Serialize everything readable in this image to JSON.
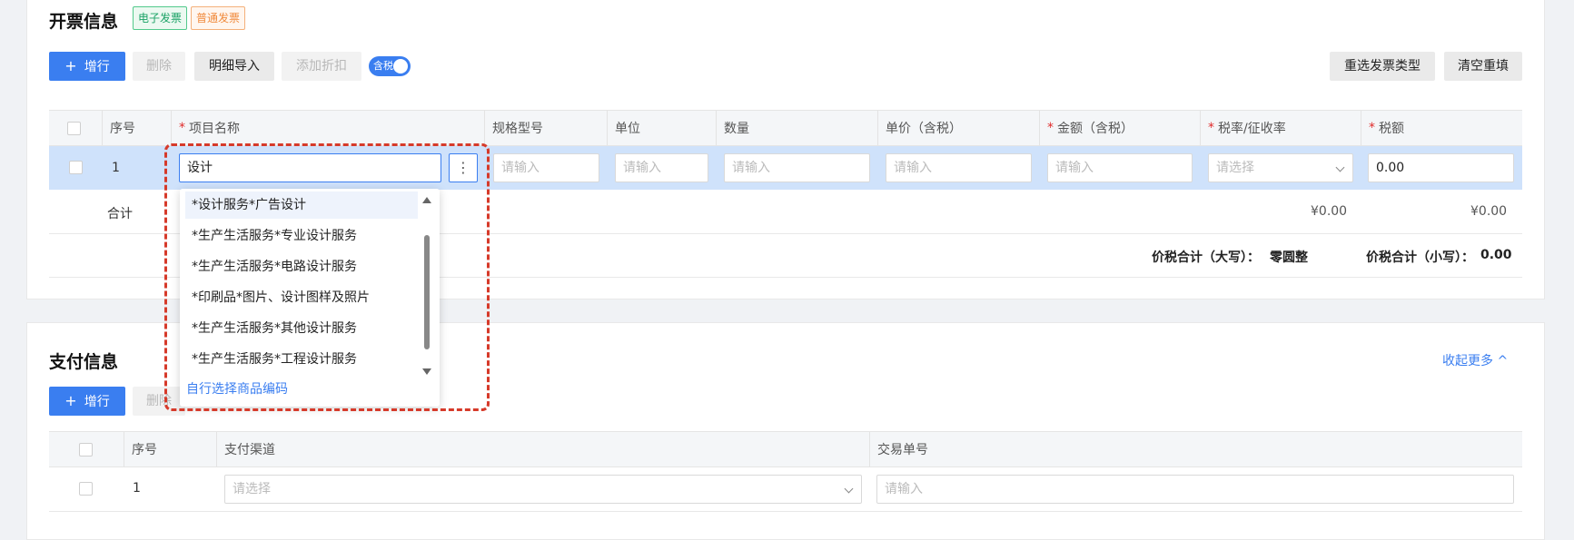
{
  "invoice": {
    "title": "开票信息",
    "tag_electronic": "电子发票",
    "tag_normal": "普通发票",
    "toolbar": {
      "add_row": "增行",
      "delete": "删除",
      "import_detail": "明细导入",
      "add_discount": "添加折扣",
      "tax_toggle": "含税",
      "reselect_type": "重选发票类型",
      "clear_refill": "清空重填"
    },
    "columns": {
      "index": "序号",
      "item_name": "项目名称",
      "spec": "规格型号",
      "unit": "单位",
      "quantity": "数量",
      "unit_price": "单价（含税）",
      "amount": "金额（含税）",
      "tax_rate": "税率/征收率",
      "tax": "税额"
    },
    "row": {
      "index": "1",
      "item_name_value": "设计",
      "input_placeholder": "请输入",
      "select_placeholder": "请选择",
      "tax_value": "0.00"
    },
    "subtotal": {
      "label": "合计",
      "amount": "¥0.00",
      "tax": "¥0.00"
    },
    "total": {
      "upper_label": "价税合计（大写）：",
      "upper_value": "零圆整",
      "lower_label": "价税合计（小写）：",
      "lower_value": "0.00"
    },
    "dropdown": {
      "items": [
        "*设计服务*广告设计",
        "*生产生活服务*专业设计服务",
        "*生产生活服务*电路设计服务",
        "*印刷品*图片、设计图样及照片",
        "*生产生活服务*其他设计服务",
        "*生产生活服务*工程设计服务"
      ],
      "custom_link": "自行选择商品编码"
    }
  },
  "payment": {
    "title": "支付信息",
    "collapse": "收起更多",
    "add_row": "增行",
    "delete": "删除",
    "columns": {
      "index": "序号",
      "channel": "支付渠道",
      "trade_no": "交易单号"
    },
    "row": {
      "index": "1",
      "channel_placeholder": "请选择",
      "trade_placeholder": "请输入"
    }
  },
  "colors": {
    "primary": "#3a7ef0",
    "highlight_row": "#cfe2fb",
    "annotation": "#d63a2a",
    "tag_green": "#1ba266",
    "tag_orange": "#f08a3c"
  }
}
